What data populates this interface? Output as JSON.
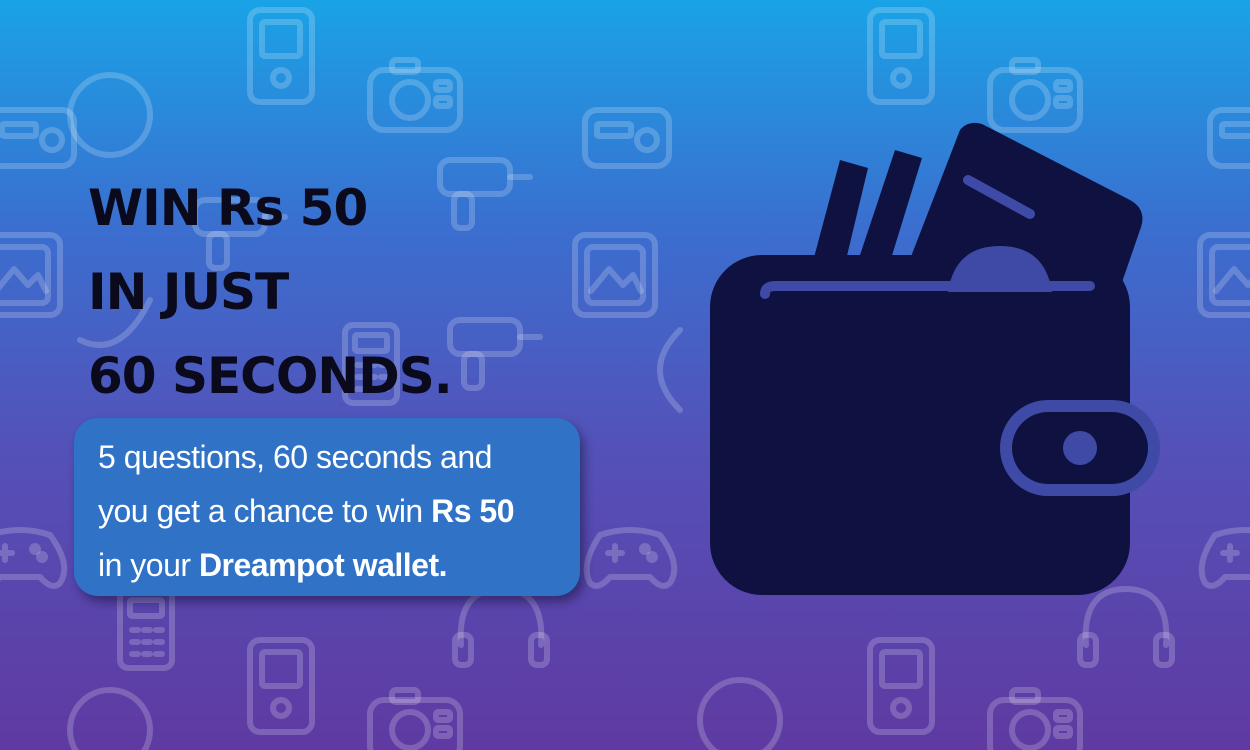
{
  "headline": {
    "line1": "WIN Rs 50",
    "line2": "IN JUST",
    "line3": "60 SECONDS."
  },
  "info": {
    "part1": "5 questions, 60 seconds and",
    "part2": "you get a chance to win ",
    "amount": "Rs 50",
    "part3": "in your ",
    "brand": "Dreampot wallet."
  },
  "colors": {
    "gradient_top": "#1aa3e6",
    "gradient_bottom": "#5f3aa2",
    "headline_text": "#0a0a1c",
    "info_box_bg": "#2f72c6",
    "wallet_fill": "#0f1240"
  },
  "icons": {
    "main": "wallet-with-cash-icon",
    "background_pattern": [
      "camera-icon",
      "phone-icon",
      "gamepad-icon",
      "headphones-icon",
      "calculator-icon",
      "radio-icon",
      "drill-icon",
      "photo-icon"
    ]
  }
}
